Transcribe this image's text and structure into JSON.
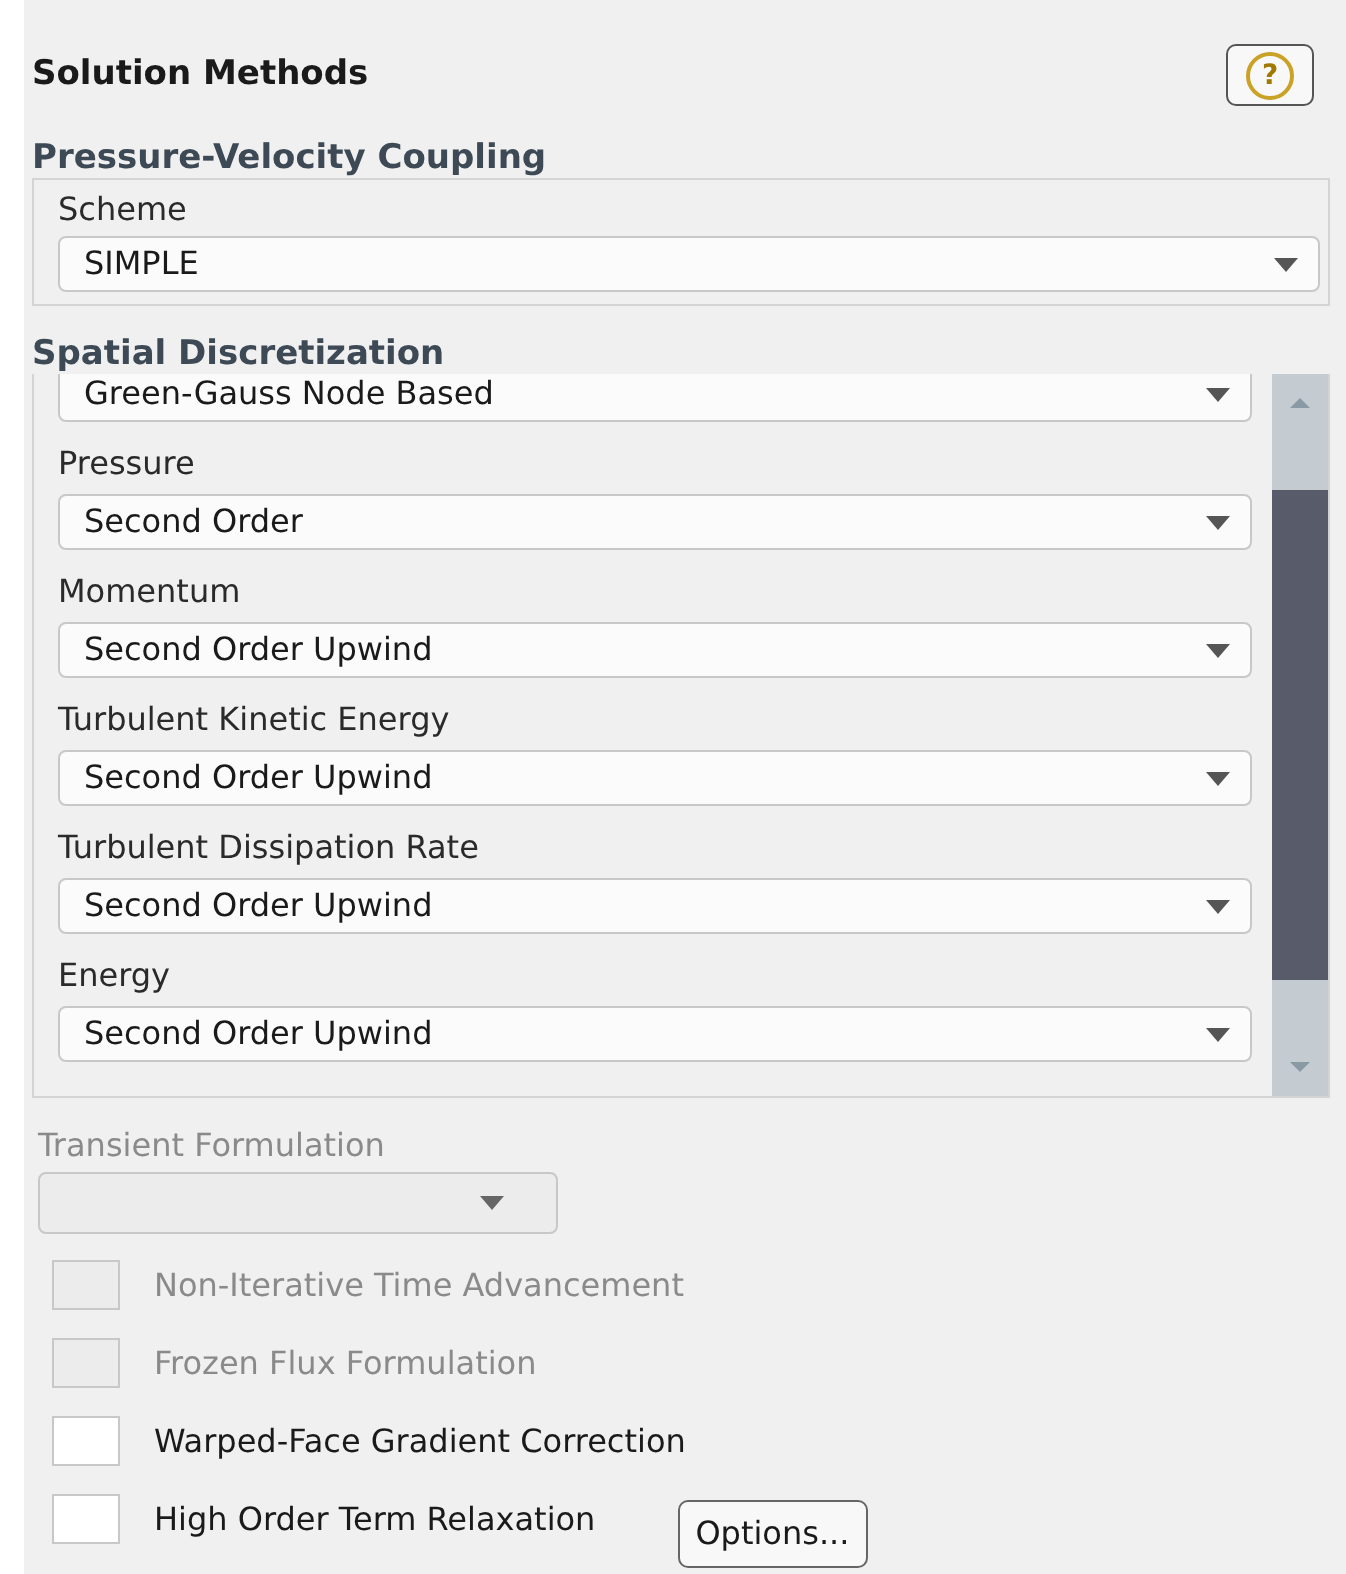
{
  "title": "Solution Methods",
  "help_button": {
    "label": "?"
  },
  "pressure_velocity_coupling": {
    "heading": "Pressure-Velocity Coupling",
    "fields": [
      {
        "label": "Scheme",
        "value": "SIMPLE"
      }
    ]
  },
  "spatial_discretization": {
    "heading": "Spatial Discretization",
    "fields": [
      {
        "value": "Green-Gauss Node Based"
      },
      {
        "label": "Pressure",
        "value": "Second Order"
      },
      {
        "label": "Momentum",
        "value": "Second Order Upwind"
      },
      {
        "label": "Turbulent Kinetic Energy",
        "value": "Second Order Upwind"
      },
      {
        "label": "Turbulent Dissipation Rate",
        "value": "Second Order Upwind"
      },
      {
        "label": "Energy",
        "value": "Second Order Upwind"
      }
    ]
  },
  "transient_formulation": {
    "label": "Transient Formulation",
    "disabled": true
  },
  "options": [
    {
      "label": "Non-Iterative Time Advancement",
      "checked": false,
      "disabled": true
    },
    {
      "label": "Frozen Flux Formulation",
      "checked": false,
      "disabled": true
    },
    {
      "label": "Warped-Face Gradient Correction",
      "checked": false,
      "disabled": false
    },
    {
      "label": "High Order Term Relaxation",
      "checked": false,
      "disabled": false,
      "button": "Options..."
    }
  ]
}
